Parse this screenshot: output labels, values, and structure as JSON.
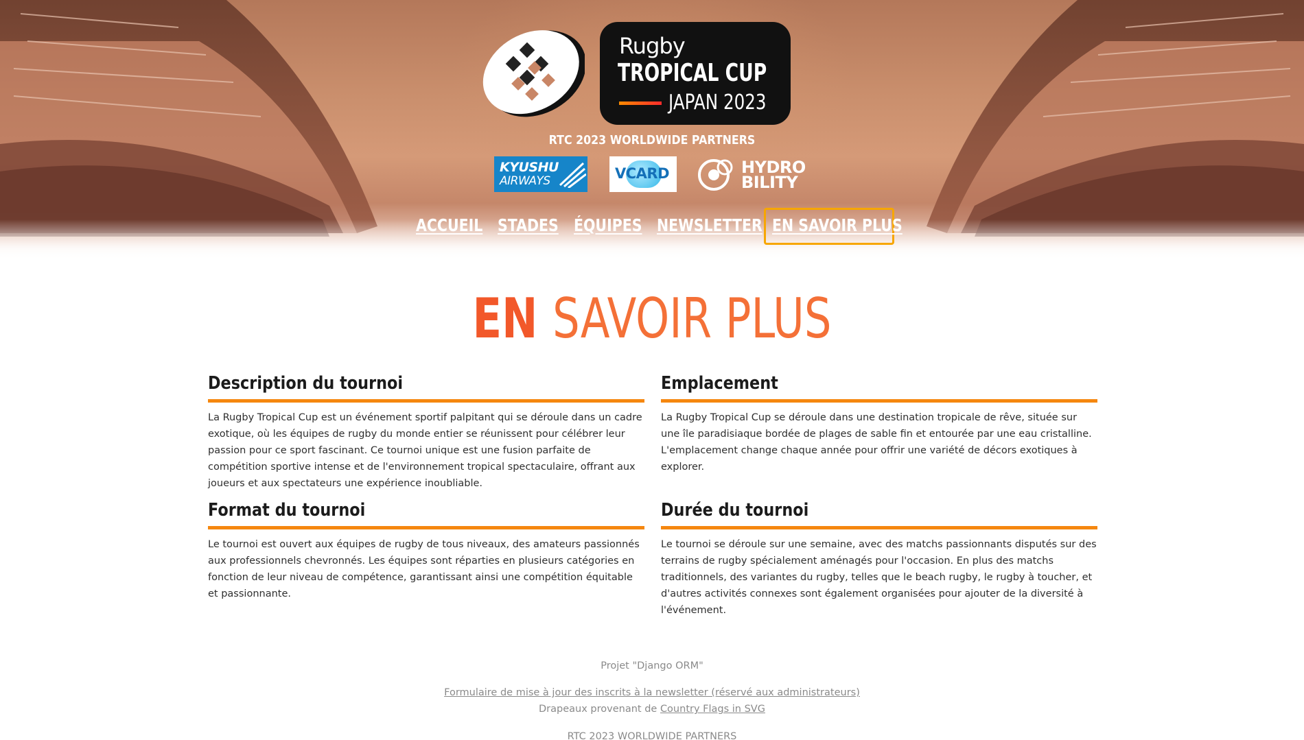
{
  "header": {
    "logo": {
      "line1": "Rugby",
      "line2": "TROPICAL CUP",
      "line3": "JAPAN 2023"
    },
    "partners_title": "RTC 2023 WORLDWIDE PARTNERS",
    "partners": {
      "kyushu": {
        "line1": "KYUSHU",
        "line2": "AIRWAYS"
      },
      "vcard": {
        "text": "VCARD"
      },
      "hydro": {
        "line1": "HYDRO",
        "line2": "BILITY"
      }
    }
  },
  "nav": {
    "items": [
      {
        "label": "ACCUEIL"
      },
      {
        "label": "STADES"
      },
      {
        "label": "ÉQUIPES"
      },
      {
        "label": "NEWSLETTER"
      },
      {
        "label": "EN SAVOIR PLUS"
      }
    ],
    "active": "EN SAVOIR PLUS"
  },
  "page": {
    "title_bold": "EN",
    "title_rest": "SAVOIR PLUS"
  },
  "sections": [
    {
      "heading": "Description du tournoi",
      "body": "La Rugby Tropical Cup est un événement sportif palpitant qui se déroule dans un cadre exotique, où les équipes de rugby du monde entier se réunissent pour célébrer leur passion pour ce sport fascinant. Ce tournoi unique est une fusion parfaite de compétition sportive intense et de l'environnement tropical spectaculaire, offrant aux joueurs et aux spectateurs une expérience inoubliable."
    },
    {
      "heading": "Emplacement",
      "body": "La Rugby Tropical Cup se déroule dans une destination tropicale de rêve, située sur une île paradisiaque bordée de plages de sable fin et entourée par une eau cristalline. L'emplacement change chaque année pour offrir une variété de décors exotiques à explorer."
    },
    {
      "heading": "Format du tournoi",
      "body": "Le tournoi est ouvert aux équipes de rugby de tous niveaux, des amateurs passionnés aux professionnels chevronnés. Les équipes sont réparties en plusieurs catégories en fonction de leur niveau de compétence, garantissant ainsi une compétition équitable et passionnante."
    },
    {
      "heading": "Durée du tournoi",
      "body": "Le tournoi se déroule sur une semaine, avec des matchs passionnants disputés sur des terrains de rugby spécialement aménagés pour l'occasion. En plus des matchs traditionnels, des variantes du rugby, telles que le beach rugby, le rugby à toucher, et d'autres activités connexes sont également organisées pour ajouter de la diversité à l'événement."
    }
  ],
  "footer": {
    "project": "Projet \"Django ORM\"",
    "admin_link": "Formulaire de mise à jour des inscrits à la newsletter (réservé aux administrateurs)",
    "flags_prefix": "Drapeaux provenant de ",
    "flags_link": "Country Flags in SVG",
    "partners_title": "RTC 2023 WORLDWIDE PARTNERS"
  },
  "colors": {
    "accent_orange": "#f5870f",
    "title_orange": "#f2582a",
    "nav_active_border": "#f7a600",
    "logo_dark": "#111111",
    "kyushu_blue": "#1685c9"
  }
}
